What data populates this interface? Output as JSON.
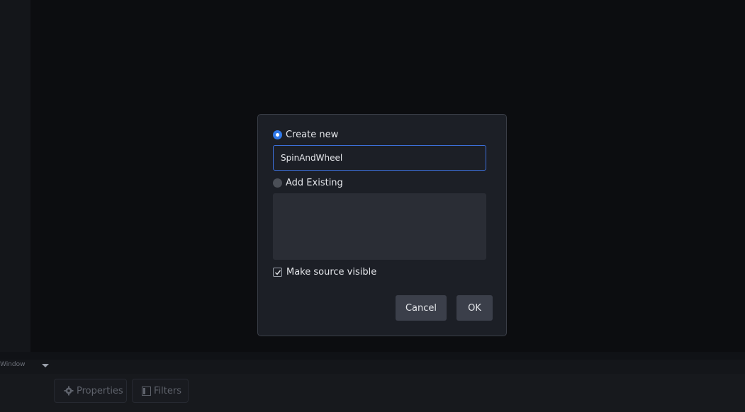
{
  "dialog": {
    "create_new_label": "Create new",
    "create_new_selected": true,
    "name_value": "SpinAndWheel",
    "add_existing_label": "Add Existing",
    "add_existing_selected": false,
    "make_visible_label": "Make source visible",
    "make_visible_checked": true,
    "cancel_label": "Cancel",
    "ok_label": "OK"
  },
  "bottom": {
    "window_label": "Window",
    "properties_label": "Properties",
    "filters_label": "Filters"
  },
  "colors": {
    "accent": "#2f78e8",
    "dialog_bg": "#1c1f26",
    "app_bg": "#0c0d10"
  }
}
